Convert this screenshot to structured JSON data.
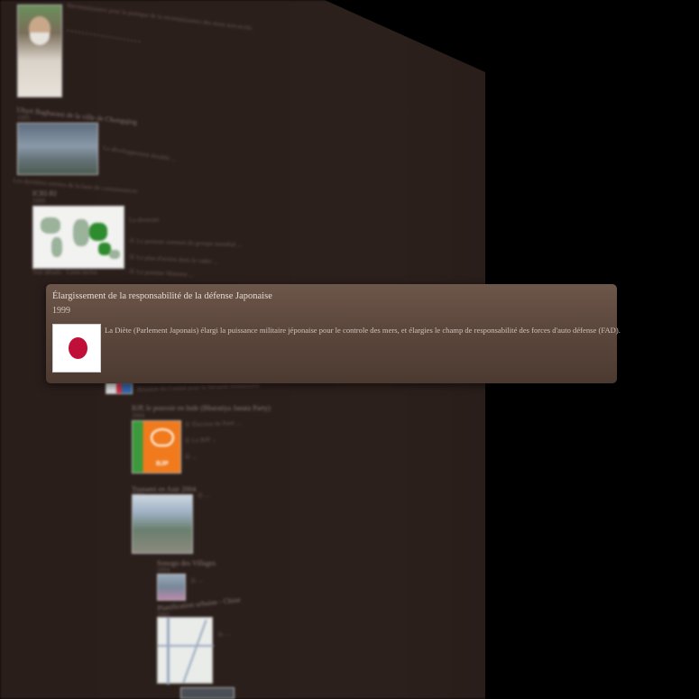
{
  "background_entries": [
    {
      "text": "Reconnaissance pour la pratique de la reconnaissance des mots non-ecrits"
    },
    {
      "text": "Ubyrt Bagharani de la ville de Chongqing"
    },
    {
      "text": "1995"
    },
    {
      "text": "Le développement durable ..."
    },
    {
      "text": "Les dernières entrées de la base de connaissances"
    },
    {
      "text": "1999"
    },
    {
      "text": "Réunion du Comité pour la Sécurité Alimentaire"
    },
    {
      "text": "BJP, le pouvoir en Inde (Bharatiya Janata Party)"
    },
    {
      "text": "2004"
    },
    {
      "text": "Tsunami en Asie 2004"
    },
    {
      "text": "2004"
    },
    {
      "text": "Sonogo des Villages"
    },
    {
      "text": "2004"
    },
    {
      "text": "Planification urbaine - Chine"
    },
    {
      "text": "2005"
    }
  ],
  "card": {
    "title": "Élargissement de la responsabilité de la défense Japonaise",
    "year": "1999",
    "description": "La Diète (Parlement Japonais) élargi la puissance militaire jéponaise pour le controle des mers, et élargies le champ de responsabilité des forces d'auto défense (FAD).",
    "flag_icon": "japan-flag-icon"
  },
  "colors": {
    "card_bg": "#5c473c",
    "panel_bg": "#2a1e1b",
    "flag_red": "#c0103a"
  }
}
